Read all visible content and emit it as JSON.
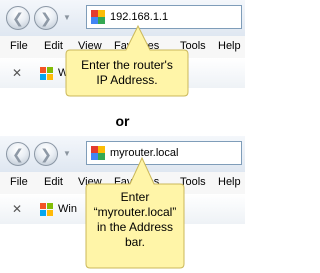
{
  "top": {
    "address": "192.168.1.1",
    "menu": [
      "File",
      "Edit",
      "View",
      "Favorites",
      "Tools",
      "Help"
    ],
    "favorite_label": "Win",
    "callout": [
      "Enter the router's",
      "IP Address."
    ]
  },
  "separator": "or",
  "bottom": {
    "address": "myrouter.local",
    "menu": [
      "File",
      "Edit",
      "View",
      "Favorites",
      "Tools",
      "Help"
    ],
    "favorite_label": "Win",
    "callout": [
      "Enter",
      "“myrouter.local”",
      "in the Address",
      "bar."
    ]
  },
  "colors": {
    "callout_fill": "#fff5a8",
    "callout_border": "#cbb85a",
    "address_border": "#7f9db9"
  },
  "icons": [
    "back-arrow-icon",
    "forward-arrow-icon",
    "dropdown-icon",
    "page-icon",
    "close-icon",
    "windows-logo-icon"
  ]
}
